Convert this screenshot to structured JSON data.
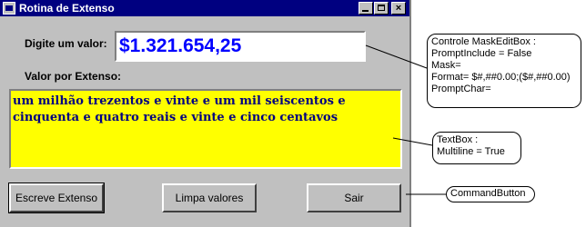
{
  "window": {
    "title": "Rotina de Extenso",
    "controls": {
      "minimize": "minimize",
      "maximize": "maximize",
      "close": "×"
    }
  },
  "form": {
    "value_label": "Digite um valor:",
    "value": "$1.321.654,25",
    "extenso_label": "Valor por Extenso:",
    "extenso_text": "um milhão trezentos e vinte e um mil seiscentos e cinquenta e quatro reais e vinte e cinco centavos"
  },
  "buttons": {
    "escreve": "Escreve Extenso",
    "limpa": "Limpa valores",
    "sair": "Sair"
  },
  "annotations": {
    "mask_edit_box": [
      "Controle MaskEditBox :",
      "PromptInclude = False",
      "Mask=",
      "Format= $#,##0.00;($#,##0.00)",
      "PromptChar="
    ],
    "textbox": [
      "TextBox :",
      "Multiline = True"
    ],
    "command_button": "CommandButton"
  },
  "colors": {
    "titlebar": "#000080",
    "window_face": "#c0c0c0",
    "input_text": "#0000ff",
    "textbox_bg": "#ffff00",
    "textbox_text": "#000080"
  }
}
